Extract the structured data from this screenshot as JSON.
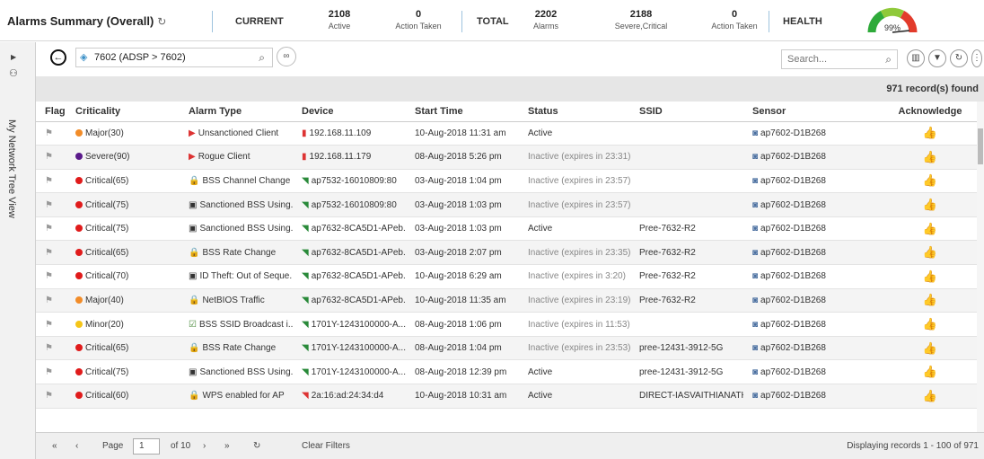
{
  "summary": {
    "title": "Alarms Summary (Overall)",
    "refresh_icon": "↻",
    "current_label": "CURRENT",
    "active": {
      "n": "2108",
      "s": "Active"
    },
    "action_taken_1": {
      "n": "0",
      "s": "Action Taken"
    },
    "total_label": "TOTAL",
    "alarms": {
      "n": "2202",
      "s": "Alarms"
    },
    "severe": {
      "n": "2188",
      "s": "Severe,Critical"
    },
    "action_taken_2": {
      "n": "0",
      "s": "Action Taken"
    },
    "health_label": "HEALTH",
    "health_pct": "99%",
    "health_value": 0.99
  },
  "rail": {
    "label": "My Network Tree View"
  },
  "toolbar": {
    "path": "7602 (ADSP > 7602)",
    "search_placeholder": "Search..."
  },
  "records_found": "971 record(s) found",
  "columns": [
    "Flag",
    "Criticality",
    "Alarm Type",
    "Device",
    "Start Time",
    "Status",
    "SSID",
    "Sensor",
    "Acknowledge"
  ],
  "rows": [
    {
      "crit": "Major(30)",
      "color": "#f28c28",
      "type": "Unsanctioned Client",
      "ticon": "client",
      "device": "192.168.11.109",
      "dicon": "device-red",
      "time": "10-Aug-2018 11:31 am",
      "status": "Active",
      "inactive": false,
      "ssid": "",
      "sensor": "ap7602-D1B268",
      "ack": false
    },
    {
      "crit": "Severe(90)",
      "color": "#5a1a8a",
      "type": "Rogue Client",
      "ticon": "client",
      "device": "192.168.11.179",
      "dicon": "device-red",
      "time": "08-Aug-2018 5:26 pm",
      "status": "Inactive (expires in 23:31)",
      "inactive": true,
      "ssid": "",
      "sensor": "ap7602-D1B268",
      "ack": false
    },
    {
      "crit": "Critical(65)",
      "color": "#e01b1b",
      "type": "BSS Channel Change ...",
      "ticon": "lock",
      "device": "ap7532-16010809:80",
      "dicon": "wifi-green",
      "time": "03-Aug-2018 1:04 pm",
      "status": "Inactive (expires in 23:57)",
      "inactive": true,
      "ssid": "",
      "sensor": "ap7602-D1B268",
      "ack": false
    },
    {
      "crit": "Critical(75)",
      "color": "#e01b1b",
      "type": "Sanctioned BSS Using...",
      "ticon": "bss",
      "device": "ap7532-16010809:80",
      "dicon": "wifi-green",
      "time": "03-Aug-2018 1:03 pm",
      "status": "Inactive (expires in 23:57)",
      "inactive": true,
      "ssid": "",
      "sensor": "ap7602-D1B268",
      "ack": false
    },
    {
      "crit": "Critical(75)",
      "color": "#e01b1b",
      "type": "Sanctioned BSS Using...",
      "ticon": "bss",
      "device": "ap7632-8CA5D1-APeb...",
      "dicon": "wifi-green",
      "time": "03-Aug-2018 1:03 pm",
      "status": "Active",
      "inactive": false,
      "ssid": "Pree-7632-R2",
      "sensor": "ap7602-D1B268",
      "ack": false
    },
    {
      "crit": "Critical(65)",
      "color": "#e01b1b",
      "type": "BSS Rate Change",
      "ticon": "lock",
      "device": "ap7632-8CA5D1-APeb...",
      "dicon": "wifi-green",
      "time": "03-Aug-2018 2:07 pm",
      "status": "Inactive (expires in 23:35)",
      "inactive": true,
      "ssid": "Pree-7632-R2",
      "sensor": "ap7602-D1B268",
      "ack": true
    },
    {
      "crit": "Critical(70)",
      "color": "#e01b1b",
      "type": "ID Theft: Out of Seque...",
      "ticon": "bss",
      "device": "ap7632-8CA5D1-APeb...",
      "dicon": "wifi-green",
      "time": "10-Aug-2018 6:29 am",
      "status": "Inactive (expires in 3:20)",
      "inactive": true,
      "ssid": "Pree-7632-R2",
      "sensor": "ap7602-D1B268",
      "ack": false
    },
    {
      "crit": "Major(40)",
      "color": "#f28c28",
      "type": "NetBIOS Traffic",
      "ticon": "lock",
      "device": "ap7632-8CA5D1-APeb...",
      "dicon": "wifi-green",
      "time": "10-Aug-2018 11:35 am",
      "status": "Inactive (expires in 23:19)",
      "inactive": true,
      "ssid": "Pree-7632-R2",
      "sensor": "ap7602-D1B268",
      "ack": false
    },
    {
      "crit": "Minor(20)",
      "color": "#f5c518",
      "type": "BSS SSID Broadcast i...",
      "ticon": "check",
      "device": "1701Y-1243100000-A...",
      "dicon": "wifi-green",
      "time": "08-Aug-2018 1:06 pm",
      "status": "Inactive (expires in 11:53)",
      "inactive": true,
      "ssid": "",
      "sensor": "ap7602-D1B268",
      "ack": false
    },
    {
      "crit": "Critical(65)",
      "color": "#e01b1b",
      "type": "BSS Rate Change",
      "ticon": "lock",
      "device": "1701Y-1243100000-A...",
      "dicon": "wifi-green",
      "time": "08-Aug-2018 1:04 pm",
      "status": "Inactive (expires in 23:53)",
      "inactive": true,
      "ssid": "pree-12431-3912-5G",
      "sensor": "ap7602-D1B268",
      "ack": false
    },
    {
      "crit": "Critical(75)",
      "color": "#e01b1b",
      "type": "Sanctioned BSS Using...",
      "ticon": "bss",
      "device": "1701Y-1243100000-A...",
      "dicon": "wifi-green",
      "time": "08-Aug-2018 12:39 pm",
      "status": "Active",
      "inactive": false,
      "ssid": "pree-12431-3912-5G",
      "sensor": "ap7602-D1B268",
      "ack": false
    },
    {
      "crit": "Critical(60)",
      "color": "#e01b1b",
      "type": "WPS enabled for AP",
      "ticon": "lock",
      "device": "2a:16:ad:24:34:d4",
      "dicon": "wifi-red",
      "time": "10-Aug-2018 10:31 am",
      "status": "Active",
      "inactive": false,
      "ssid": "DIRECT-IASVAITHIANATH-...",
      "sensor": "ap7602-D1B268",
      "ack": false
    }
  ],
  "pager": {
    "page_label": "Page",
    "page_value": "1",
    "of_label": "of 10",
    "clear_filters": "Clear Filters",
    "displaying": "Displaying records 1 - 100 of 971"
  }
}
